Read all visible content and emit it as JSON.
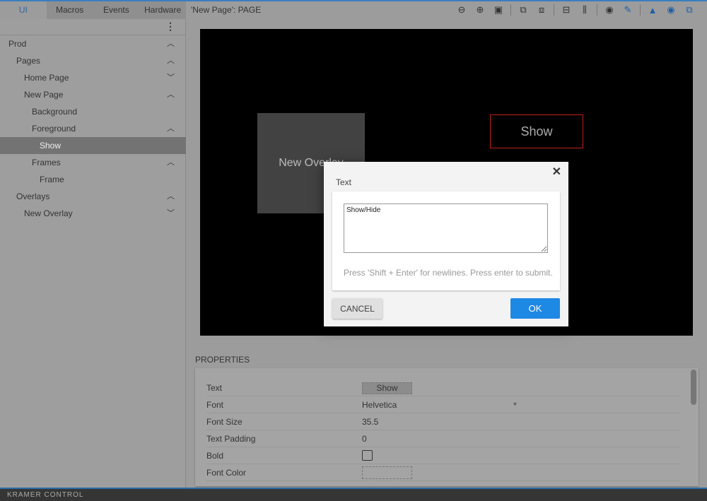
{
  "tabs": [
    {
      "label": "UI",
      "active": true
    },
    {
      "label": "Macros"
    },
    {
      "label": "Events"
    },
    {
      "label": "Hardware"
    }
  ],
  "page_title": "'New Page': PAGE",
  "toolbar": [
    {
      "icon": "zoom-out-icon",
      "glyph": "⊖"
    },
    {
      "icon": "zoom-in-icon",
      "glyph": "⊕"
    },
    {
      "icon": "zoom-fit-icon",
      "glyph": "▣"
    },
    {
      "sep": true
    },
    {
      "icon": "group-icon",
      "glyph": "⧉"
    },
    {
      "icon": "ungroup-icon",
      "glyph": "⧈"
    },
    {
      "sep": true
    },
    {
      "icon": "align-center-icon",
      "glyph": "⊟"
    },
    {
      "icon": "distribute-icon",
      "glyph": "⫼"
    },
    {
      "sep": true
    },
    {
      "icon": "record-icon",
      "glyph": "◉"
    },
    {
      "icon": "pencil-icon",
      "glyph": "✎",
      "blue": true
    },
    {
      "sep": true
    },
    {
      "icon": "image-icon",
      "glyph": "▲",
      "blue": true
    },
    {
      "icon": "radio-icon",
      "glyph": "◉",
      "blue": true
    },
    {
      "icon": "layers-icon",
      "glyph": "⧉",
      "blue": true
    }
  ],
  "tree": [
    {
      "label": "Prod",
      "level": 0,
      "chevron": "up"
    },
    {
      "label": "Pages",
      "level": 1,
      "chevron": "up"
    },
    {
      "label": "Home Page",
      "level": 2,
      "chevron": "down"
    },
    {
      "label": "New Page",
      "level": 2,
      "chevron": "up"
    },
    {
      "label": "Background",
      "level": 3
    },
    {
      "label": "Foreground",
      "level": 3,
      "chevron": "up"
    },
    {
      "label": "Show",
      "level": 4,
      "selected": true
    },
    {
      "label": "Frames",
      "level": 3,
      "chevron": "up"
    },
    {
      "label": "Frame",
      "level": 4
    },
    {
      "label": "Overlays",
      "level": 1,
      "chevron": "up"
    },
    {
      "label": "New Overlay",
      "level": 2,
      "chevron": "down"
    }
  ],
  "canvas": {
    "overlay_label": "New Overlay",
    "button_label": "Show",
    "button_border": "#c0221b"
  },
  "properties": {
    "title": "PROPERTIES",
    "rows": [
      {
        "label": "Text",
        "value": "Show"
      },
      {
        "label": "Font",
        "value": "Helvetica"
      },
      {
        "label": "Font Size",
        "value": "35.5"
      },
      {
        "label": "Text Padding",
        "value": "0"
      },
      {
        "label": "Bold",
        "value": ""
      },
      {
        "label": "Font Color",
        "value": ""
      }
    ]
  },
  "dialog": {
    "label": "Text",
    "value": "Show/Hide",
    "hint": "Press 'Shift + Enter' for newlines. Press enter to submit.",
    "cancel": "CANCEL",
    "ok": "OK",
    "accent": "#1e88e5"
  },
  "footer": {
    "brand": "KRAMER CONTROL"
  }
}
